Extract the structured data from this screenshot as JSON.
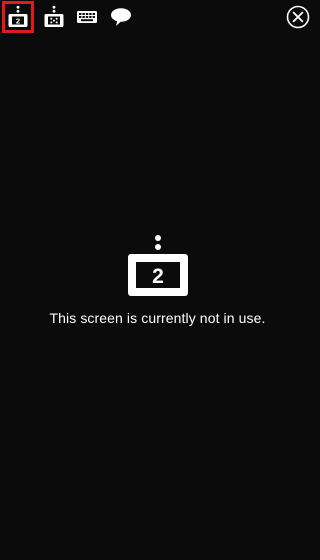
{
  "toolbar": {
    "screen_button_number": "2",
    "icons": {
      "current_screen": "screen-2-icon",
      "other_screen": "screen-dots-icon",
      "keyboard": "keyboard-icon",
      "chat": "speech-bubble-icon",
      "close": "close-circle-icon"
    },
    "selected_highlight_color": "#e01b1b"
  },
  "main": {
    "screen_number": "2",
    "status_message": "This screen is currently not in use."
  },
  "colors": {
    "background": "#0b0b0b",
    "foreground": "#ffffff"
  }
}
